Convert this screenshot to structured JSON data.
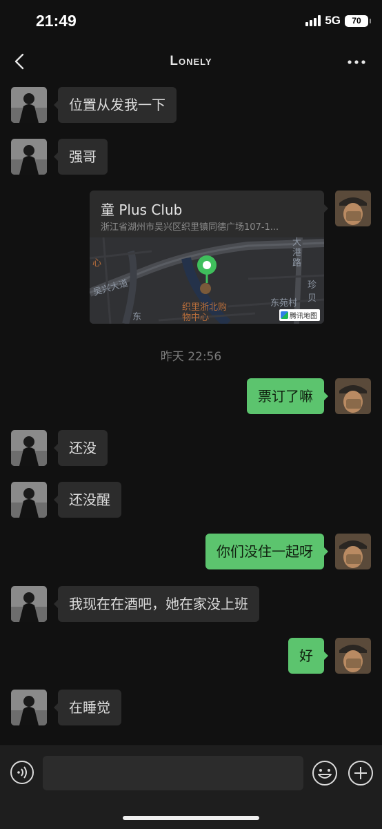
{
  "status_bar": {
    "time": "21:49",
    "network": "5G",
    "battery": "70"
  },
  "header": {
    "title": "Lonely",
    "back_icon": "chevron-left-icon",
    "more_icon": "more-dots-icon"
  },
  "messages": [
    {
      "side": "left",
      "text": "位置从发我一下"
    },
    {
      "side": "left",
      "text": "强哥"
    },
    {
      "side": "right",
      "type": "location",
      "name": "童 Plus Club",
      "address": "浙江省湖州市吴兴区织里镇同德广场107-1...",
      "map_labels": {
        "road1": "吴兴大道",
        "road2": "大港路",
        "poi": "织里浙北购物中心",
        "place1": "东苑村",
        "place2": "珍贝",
        "frag1": "心",
        "frag2": "东",
        "badge": "腾讯地图"
      }
    },
    {
      "type": "timestamp",
      "text": "昨天 22:56"
    },
    {
      "side": "right",
      "text": "票订了嘛"
    },
    {
      "side": "left",
      "text": "还没"
    },
    {
      "side": "left",
      "text": "还没醒"
    },
    {
      "side": "right",
      "text": "你们没住一起呀"
    },
    {
      "side": "left",
      "text": "我现在在酒吧，她在家没上班"
    },
    {
      "side": "right",
      "text": "好"
    },
    {
      "side": "left",
      "text": "在睡觉"
    }
  ],
  "input_bar": {
    "placeholder": "",
    "voice_icon": "voice-icon",
    "emoji_icon": "emoji-icon",
    "plus_icon": "plus-icon"
  },
  "colors": {
    "background": "#111111",
    "bubble_left": "#2c2c2c",
    "bubble_right": "#5cc46e",
    "map_pin": "#3fbf5c"
  }
}
